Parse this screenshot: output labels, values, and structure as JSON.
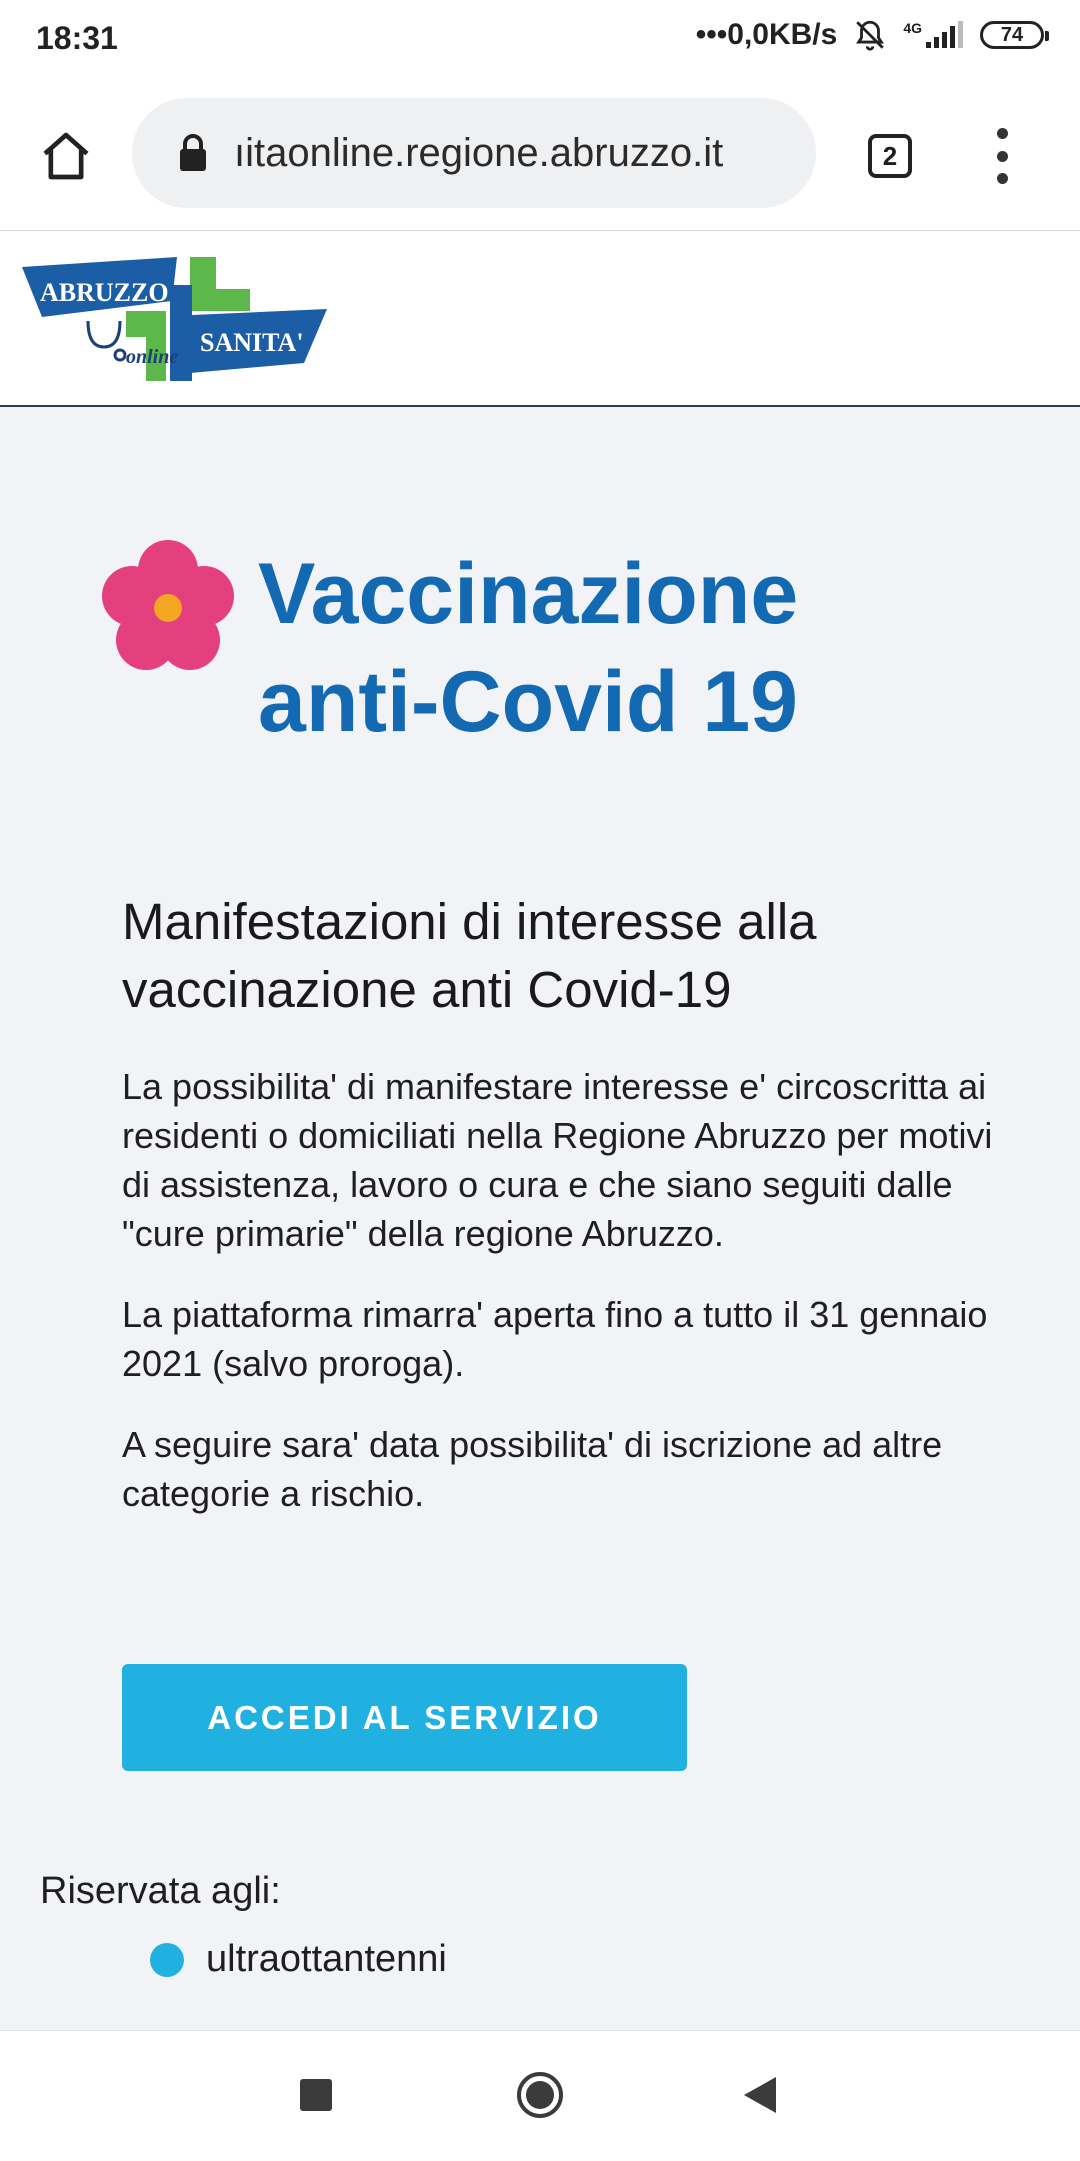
{
  "status_bar": {
    "time": "18:31",
    "net_speed": "•••0,0KB/s",
    "network_type": "4G",
    "battery": "74"
  },
  "browser": {
    "url": "ıitaonline.regione.abruzzo.it",
    "tab_count": "2",
    "icons": [
      "home-icon",
      "lock-icon",
      "tabs-icon",
      "more-vert-icon"
    ]
  },
  "site": {
    "logo_text_top": "ABRUZZO",
    "logo_text_bottom": "SANITA'",
    "logo_text_online": "online"
  },
  "hero": {
    "title_line1": "Vaccinazione",
    "title_line2": "anti-Covid 19",
    "icon": "flower-icon",
    "title_color": "#1369b2",
    "flower_color": "#e4407e"
  },
  "content": {
    "subtitle": "Manifestazioni di interesse alla vaccinazione anti Covid-19",
    "paragraphs": [
      "La possibilita' di manifestare interesse e' circoscritta ai residenti o domiciliati nella Regione Abruzzo per motivi di assistenza, lavoro o cura e che siano seguiti dalle \"cure primarie\" della regione Abruzzo.",
      "La piattaforma rimarra' aperta fino a tutto il 31 gennaio 2021 (salvo proroga).",
      "A seguire sara' data possibilita' di iscrizione ad altre categorie a rischio."
    ]
  },
  "cta": {
    "label": "ACCEDI AL SERVIZIO",
    "color": "#20b1e0"
  },
  "reserved": {
    "label": "Riservata agli:",
    "items": [
      "ultraottantenni"
    ]
  }
}
